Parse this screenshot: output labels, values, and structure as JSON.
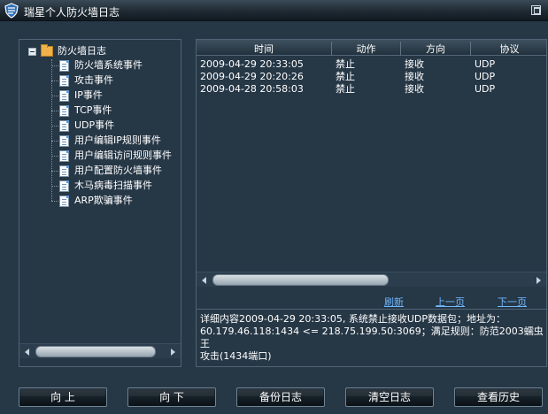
{
  "window": {
    "title": "瑞星个人防火墙日志"
  },
  "tree": {
    "root_label": "防火墙日志",
    "items": [
      "防火墙系统事件",
      "攻击事件",
      "IP事件",
      "TCP事件",
      "UDP事件",
      "用户编辑IP规则事件",
      "用户编辑访问规则事件",
      "用户配置防火墙事件",
      "木马病毒扫描事件",
      "ARP欺骗事件"
    ]
  },
  "log_table": {
    "columns": [
      "时间",
      "动作",
      "方向",
      "协议"
    ],
    "rows": [
      [
        "2009-04-29 20:33:05",
        "禁止",
        "接收",
        "UDP"
      ],
      [
        "2009-04-29 20:20:26",
        "禁止",
        "接收",
        "UDP"
      ],
      [
        "2009-04-28 20:58:03",
        "禁止",
        "接收",
        "UDP"
      ]
    ]
  },
  "pagination": {
    "refresh": "刷新",
    "prev": "上一页",
    "next": "下一页"
  },
  "detail_text": "详细内容2009-04-29 20:33:05, 系统禁止接收UDP数据包；地址为：\n60.179.46.118:1434 <= 218.75.199.50:3069；满足规则：防范2003蠕虫王\n攻击(1434端口)",
  "buttons": {
    "up": "向 上",
    "down": "向 下",
    "backup": "备份日志",
    "clear": "清空日志",
    "history": "查看历史"
  },
  "colors": {
    "background": "#263746",
    "border": "#4f6474",
    "link": "#6fb8ff",
    "folder": "#f0b24a"
  }
}
